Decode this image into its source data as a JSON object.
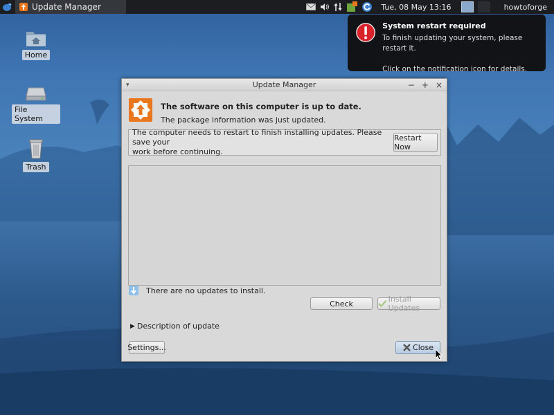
{
  "panel": {
    "task_title": "Update Manager",
    "clock": "Tue, 08 May  13:16",
    "user": "howtoforge"
  },
  "desktop": {
    "icons": [
      {
        "label": "Home",
        "icon": "home-folder-icon"
      },
      {
        "label": "File System",
        "icon": "drive-icon"
      },
      {
        "label": "Trash",
        "icon": "trash-icon"
      }
    ]
  },
  "notification": {
    "title": "System restart required",
    "line1": "To finish updating your system, please restart it.",
    "line2": "Click on the notification icon for details."
  },
  "window": {
    "title": "Update Manager",
    "heading": "The software on this computer is up to date.",
    "subheading": "The package information was just updated.",
    "restart_message_1": "The computer needs to restart to finish installing updates. Please save your",
    "restart_message_2": "work before continuing.",
    "restart_button": "Restart Now",
    "status": "There are no updates to install.",
    "check_button": "Check",
    "install_button": "Install Updates",
    "description_label": "Description of update",
    "settings_button": "Settings...",
    "close_button": "Close"
  },
  "colors": {
    "panel_bg": "#1b1d20",
    "desktop_blue": "#3f76b3",
    "notif_bg": "#111316",
    "window_bg": "#d9d9d9",
    "update_icon_orange": "#e8771e",
    "alert_red": "#d8232a"
  }
}
